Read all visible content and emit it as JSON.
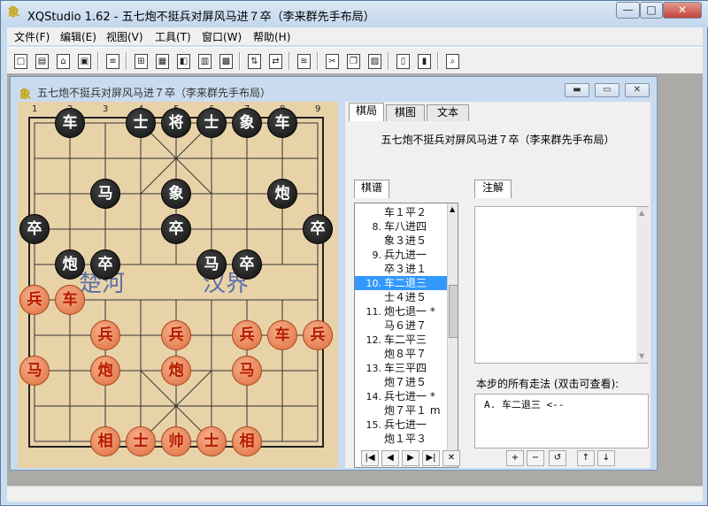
{
  "window": {
    "title": "XQStudio 1.62 - 五七炮不挺兵对屏风马进７卒（李来群先手布局）"
  },
  "menus": [
    "文件(F)",
    "编辑(E)",
    "视图(V)",
    "工具(T)",
    "窗口(W)",
    "帮助(H)"
  ],
  "toolbar_icons": [
    "new-icon",
    "new-template-icon",
    "open-icon",
    "save-icon",
    "list-icon",
    "board-setup-icon",
    "export-icon",
    "export2-icon",
    "copy-board-icon",
    "copy-board2-icon",
    "flip-vertical-icon",
    "flip-horizontal-icon",
    "step-icon",
    "cut-icon",
    "copy-icon",
    "paste-icon",
    "page-icon",
    "page2-icon",
    "print-preview-icon"
  ],
  "document": {
    "title": "五七炮不挺兵对屏风马进７卒（李来群先手布局）"
  },
  "board": {
    "files": [
      "1",
      "2",
      "3",
      "4",
      "5",
      "6",
      "7",
      "8",
      "9"
    ],
    "river_left": "楚河",
    "river_right": "汉界",
    "pieces": [
      {
        "side": "black",
        "name": "车",
        "file": 2,
        "rank": 1
      },
      {
        "side": "black",
        "name": "士",
        "file": 4,
        "rank": 1
      },
      {
        "side": "black",
        "name": "将",
        "file": 5,
        "rank": 1
      },
      {
        "side": "black",
        "name": "士",
        "file": 6,
        "rank": 1
      },
      {
        "side": "black",
        "name": "象",
        "file": 7,
        "rank": 1
      },
      {
        "side": "black",
        "name": "车",
        "file": 8,
        "rank": 1
      },
      {
        "side": "black",
        "name": "马",
        "file": 3,
        "rank": 3
      },
      {
        "side": "black",
        "name": "象",
        "file": 5,
        "rank": 3
      },
      {
        "side": "black",
        "name": "炮",
        "file": 8,
        "rank": 3
      },
      {
        "side": "black",
        "name": "卒",
        "file": 1,
        "rank": 4
      },
      {
        "side": "black",
        "name": "卒",
        "file": 5,
        "rank": 4
      },
      {
        "side": "black",
        "name": "卒",
        "file": 9,
        "rank": 4
      },
      {
        "side": "black",
        "name": "炮",
        "file": 2,
        "rank": 5
      },
      {
        "side": "black",
        "name": "卒",
        "file": 3,
        "rank": 5
      },
      {
        "side": "black",
        "name": "马",
        "file": 6,
        "rank": 5
      },
      {
        "side": "black",
        "name": "卒",
        "file": 7,
        "rank": 5
      },
      {
        "side": "red",
        "name": "兵",
        "file": 1,
        "rank": 6
      },
      {
        "side": "red",
        "name": "车",
        "file": 2,
        "rank": 6
      },
      {
        "side": "red",
        "name": "兵",
        "file": 3,
        "rank": 7
      },
      {
        "side": "red",
        "name": "兵",
        "file": 5,
        "rank": 7
      },
      {
        "side": "red",
        "name": "兵",
        "file": 7,
        "rank": 7
      },
      {
        "side": "red",
        "name": "车",
        "file": 8,
        "rank": 7
      },
      {
        "side": "red",
        "name": "兵",
        "file": 9,
        "rank": 7
      },
      {
        "side": "red",
        "name": "马",
        "file": 1,
        "rank": 8
      },
      {
        "side": "red",
        "name": "炮",
        "file": 3,
        "rank": 8
      },
      {
        "side": "red",
        "name": "炮",
        "file": 5,
        "rank": 8
      },
      {
        "side": "red",
        "name": "马",
        "file": 7,
        "rank": 8
      },
      {
        "side": "red",
        "name": "相",
        "file": 3,
        "rank": 10
      },
      {
        "side": "red",
        "name": "士",
        "file": 4,
        "rank": 10
      },
      {
        "side": "red",
        "name": "帅",
        "file": 5,
        "rank": 10
      },
      {
        "side": "red",
        "name": "士",
        "file": 6,
        "rank": 10
      },
      {
        "side": "red",
        "name": "相",
        "file": 7,
        "rank": 10
      }
    ]
  },
  "tabs": [
    "棋局",
    "棋图",
    "文本"
  ],
  "opening_title": "五七炮不挺兵对屏风马进７卒（李来群先手布局）",
  "moves_label": "棋谱",
  "notes_label": "注解",
  "moves": [
    {
      "num": "",
      "text": "车１平２"
    },
    {
      "num": "8.",
      "text": "车八进四"
    },
    {
      "num": "",
      "text": "象３进５"
    },
    {
      "num": "9.",
      "text": "兵九进一"
    },
    {
      "num": "",
      "text": "卒３进１"
    },
    {
      "num": "10.",
      "text": "车二退三",
      "selected": true
    },
    {
      "num": "",
      "text": "士４进５"
    },
    {
      "num": "11.",
      "text": "炮七退一 *"
    },
    {
      "num": "",
      "text": "马６进７"
    },
    {
      "num": "12.",
      "text": "车二平三"
    },
    {
      "num": "",
      "text": "炮８平７"
    },
    {
      "num": "13.",
      "text": "车三平四"
    },
    {
      "num": "",
      "text": "炮７进５"
    },
    {
      "num": "14.",
      "text": "兵七进一 *"
    },
    {
      "num": "",
      "text": "炮７平１ m"
    },
    {
      "num": "15.",
      "text": "兵七进一"
    },
    {
      "num": "",
      "text": "炮１平３"
    }
  ],
  "all_moves_label": "本步的所有走法 (双击可查看):",
  "all_moves": [
    "A. 车二退三 <--"
  ],
  "nav_buttons": [
    "|◀",
    "◀",
    "▶",
    "▶|",
    "✕"
  ],
  "edit_buttons": [
    "+",
    "−",
    "↺",
    "↑",
    "↓"
  ]
}
